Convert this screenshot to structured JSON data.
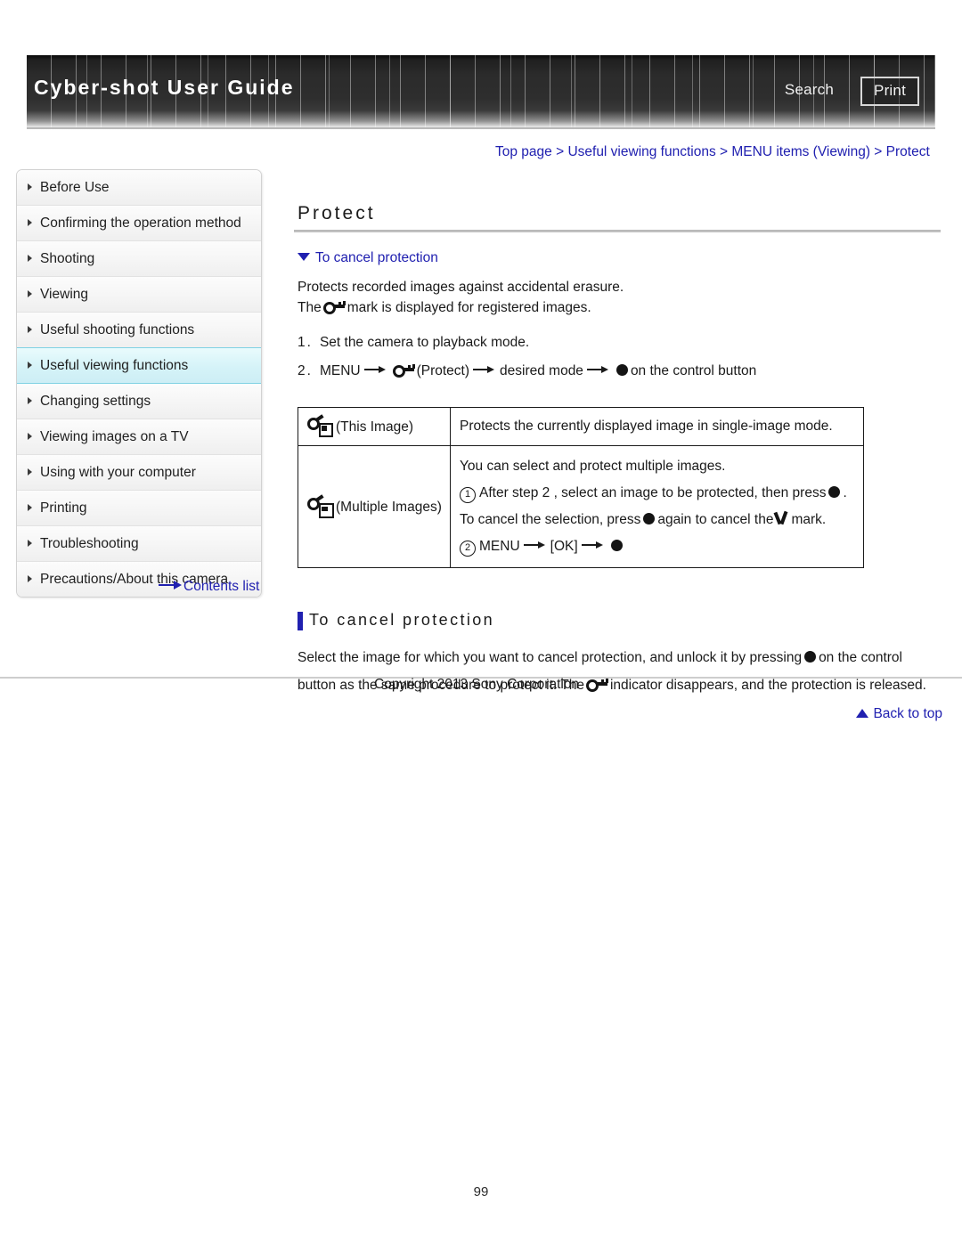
{
  "header": {
    "guide_title": "Cyber-shot User Guide",
    "search_label": "Search",
    "print_label": "Print"
  },
  "breadcrumb": {
    "text": "Top page > Useful viewing functions > MENU items (Viewing) > Protect"
  },
  "sidebar": {
    "items": [
      {
        "label": "Before Use",
        "active": false
      },
      {
        "label": "Confirming the operation method",
        "active": false
      },
      {
        "label": "Shooting",
        "active": false
      },
      {
        "label": "Viewing",
        "active": false
      },
      {
        "label": "Useful shooting functions",
        "active": false
      },
      {
        "label": "Useful viewing functions",
        "active": true
      },
      {
        "label": "Changing settings",
        "active": false
      },
      {
        "label": "Viewing images on a TV",
        "active": false
      },
      {
        "label": "Using with your computer",
        "active": false
      },
      {
        "label": "Printing",
        "active": false
      },
      {
        "label": "Troubleshooting",
        "active": false
      },
      {
        "label": "Precautions/About this camera",
        "active": false
      }
    ],
    "contents_list_label": "Contents list"
  },
  "main": {
    "title": "Protect",
    "anchor_link": "To cancel protection",
    "intro_line1": "Protects recorded images against accidental erasure.",
    "intro_line2_before": "The",
    "intro_line2_after": "mark is displayed for registered images.",
    "steps": [
      {
        "num": "1.",
        "text": "Set the camera to playback mode."
      }
    ],
    "step2": {
      "num": "2.",
      "menu": "MENU",
      "protect_label": "(Protect)",
      "desired_mode": "desired mode",
      "tail": "on the control button"
    },
    "table": {
      "rows": [
        {
          "label": "(This Image)",
          "icon": "key-single-image-icon",
          "lines": [
            "Protects the currently displayed image in single-image mode."
          ]
        },
        {
          "label": "(Multiple Images)",
          "icon": "key-multiple-images-icon",
          "lines": [
            "You can select and protect multiple images."
          ],
          "step1_num": "1",
          "step1_before": "After step 2 , select an image to be protected, then press",
          "step1_after": ".",
          "cancel_before": "To cancel the selection, press",
          "cancel_middle": "again to cancel the",
          "cancel_after": "mark.",
          "step2_num": "2",
          "step2_menu": "MENU",
          "step2_ok": "[OK]"
        }
      ]
    },
    "section2": {
      "heading": "To cancel protection",
      "line1_before": "Select the image for which you want to cancel protection, and unlock it by pressing",
      "line1_after": "on the control",
      "line2_before": "button as the same procedure to protect it. The",
      "line2_after": "indicator disappears, and the protection is released."
    },
    "back_to_top": "Back to top"
  },
  "footer": {
    "copyright": "Copyright 2013 Sony Corporation",
    "page_number": "99"
  },
  "colors": {
    "link_blue": "#2020b0",
    "header_dark": "#2b2b2b",
    "active_cyan": "#cdeef5"
  }
}
